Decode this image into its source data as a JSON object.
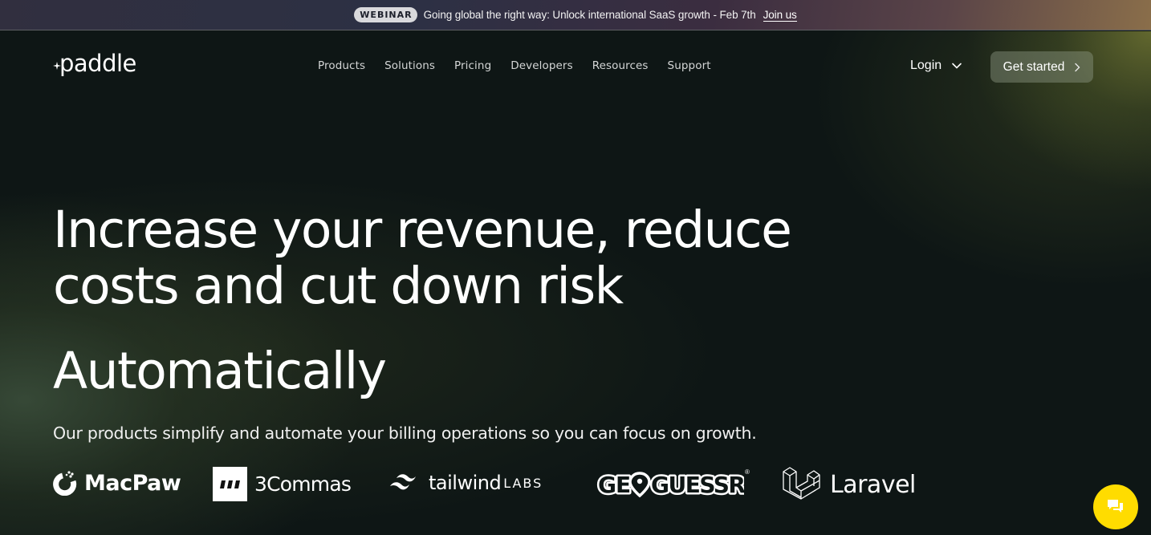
{
  "banner": {
    "badge": "WEBINAR",
    "text": "Going global the right way: Unlock international SaaS growth - Feb 7th",
    "link": "Join us"
  },
  "header": {
    "logo": "paddle",
    "nav": [
      {
        "label": "Products"
      },
      {
        "label": "Solutions"
      },
      {
        "label": "Pricing"
      },
      {
        "label": "Developers"
      },
      {
        "label": "Resources"
      },
      {
        "label": "Support"
      }
    ],
    "login": "Login",
    "cta": "Get started"
  },
  "hero": {
    "headline_line1": "Increase your revenue, reduce",
    "headline_line2": "costs and cut down risk",
    "headline_accent": "Automatically",
    "subtext": "Our products simplify and automate your billing operations so you can focus on growth."
  },
  "customers": {
    "logos": [
      {
        "name": "MacPaw",
        "icon": "macpaw-icon"
      },
      {
        "name": "3Commas",
        "icon": "3commas-icon"
      },
      {
        "name": "tailwind",
        "suffix": "LABS",
        "icon": "tailwind-icon"
      },
      {
        "name": "GEOGUESSR",
        "icon": "map-pin-icon",
        "mark": "®"
      },
      {
        "name": "Laravel",
        "icon": "laravel-icon"
      }
    ]
  },
  "chat": {
    "icon": "chat-bubbles-icon",
    "color": "#ffdc00"
  },
  "colors": {
    "background": "#0e1615",
    "text": "#ffffff",
    "nav_text": "#d4d6d6",
    "badge_bg": "#d9d9dc"
  }
}
